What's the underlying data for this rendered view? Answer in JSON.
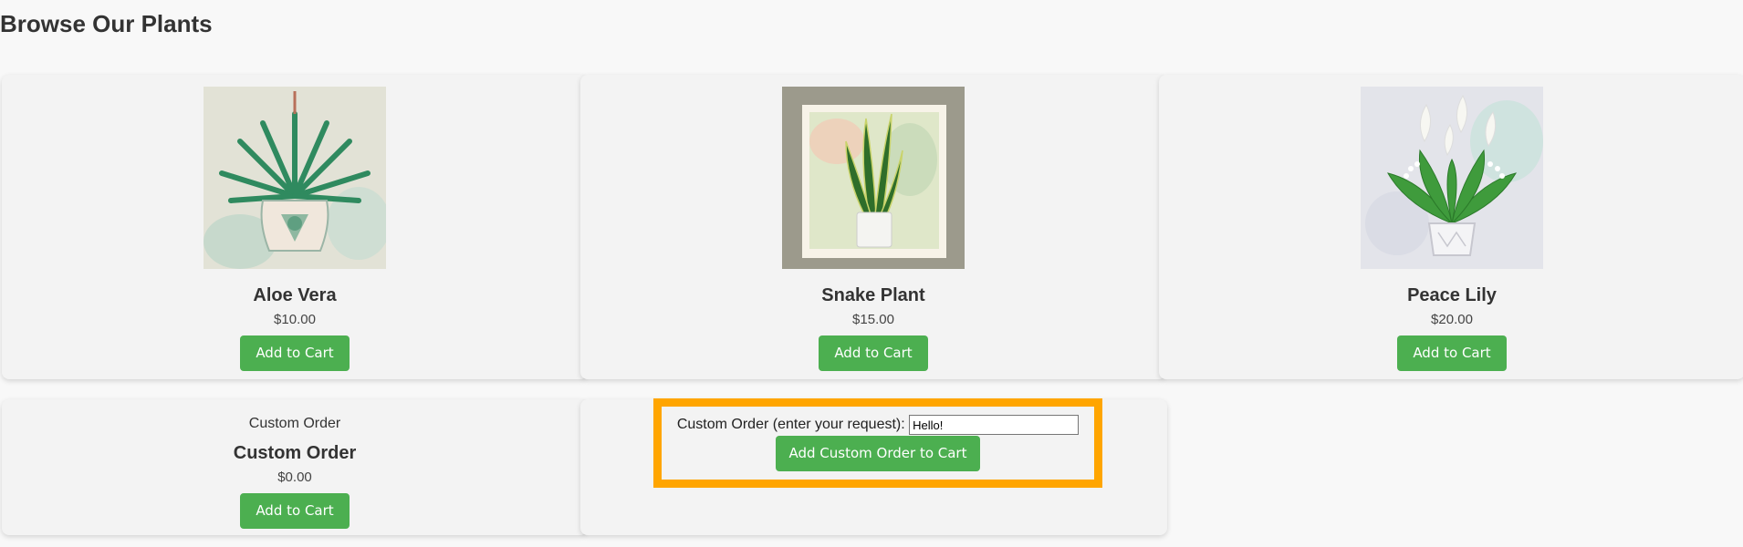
{
  "page": {
    "title": "Browse Our Plants"
  },
  "products": [
    {
      "name": "Aloe Vera",
      "price": "$10.00",
      "button": "Add to Cart",
      "image_icon": "aloe-vera-image"
    },
    {
      "name": "Snake Plant",
      "price": "$15.00",
      "button": "Add to Cart",
      "image_icon": "snake-plant-image"
    },
    {
      "name": "Peace Lily",
      "price": "$20.00",
      "button": "Add to Cart",
      "image_icon": "peace-lily-image"
    }
  ],
  "custom_order": {
    "top_label": "Custom Order",
    "name": "Custom Order",
    "price": "$0.00",
    "button": "Add to Cart"
  },
  "custom_form": {
    "label": "Custom Order (enter your request):",
    "input_value": "Hello!",
    "submit": "Add Custom Order to Cart"
  },
  "colors": {
    "accent_green": "#4caf50",
    "highlight_orange": "#ffa500",
    "card_bg": "#f3f3f3",
    "page_bg": "#f8f8f8"
  }
}
